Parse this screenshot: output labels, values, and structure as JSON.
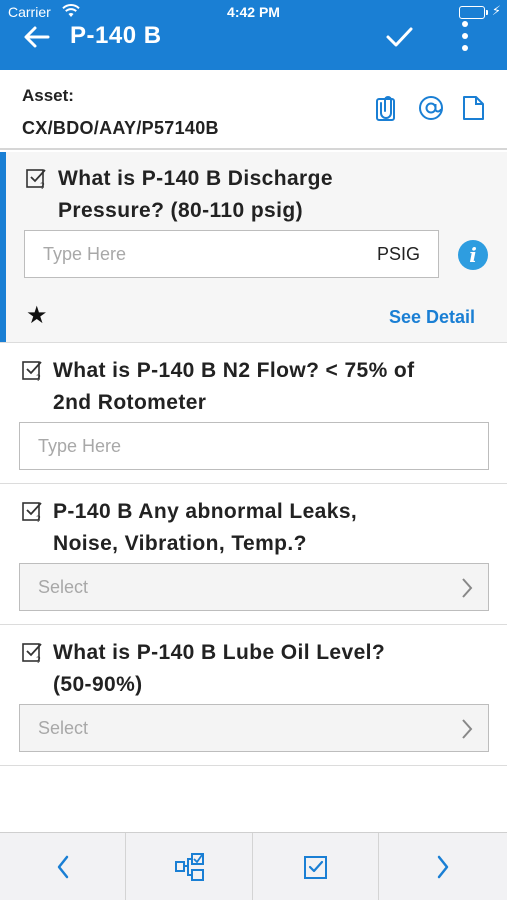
{
  "status_bar": {
    "carrier": "Carrier",
    "time": "4:42 PM"
  },
  "header": {
    "title": "P-140 B"
  },
  "asset": {
    "label": "Asset:",
    "value": "CX/BDO/AAY/P57140B"
  },
  "questions": [
    {
      "text_line1": "What is P-140 B Discharge",
      "text_line2": "Pressure? (80-110 psig)",
      "input_placeholder": "Type Here",
      "unit": "PSIG",
      "info_label": "i",
      "star": "★",
      "see_detail": "See Detail"
    },
    {
      "text_line1": "What is P-140 B N2 Flow? < 75% of",
      "text_line2": "2nd Rotometer",
      "input_placeholder": "Type Here"
    },
    {
      "text_line1": "P-140 B Any abnormal Leaks,",
      "text_line2": "Noise, Vibration, Temp.?",
      "select_placeholder": "Select"
    },
    {
      "text_line1": "What is P-140 B Lube Oil Level?",
      "text_line2": "(50-90%)",
      "select_placeholder": "Select"
    }
  ],
  "colors": {
    "brand": "#1a7fd4",
    "info": "#2e9de0"
  }
}
